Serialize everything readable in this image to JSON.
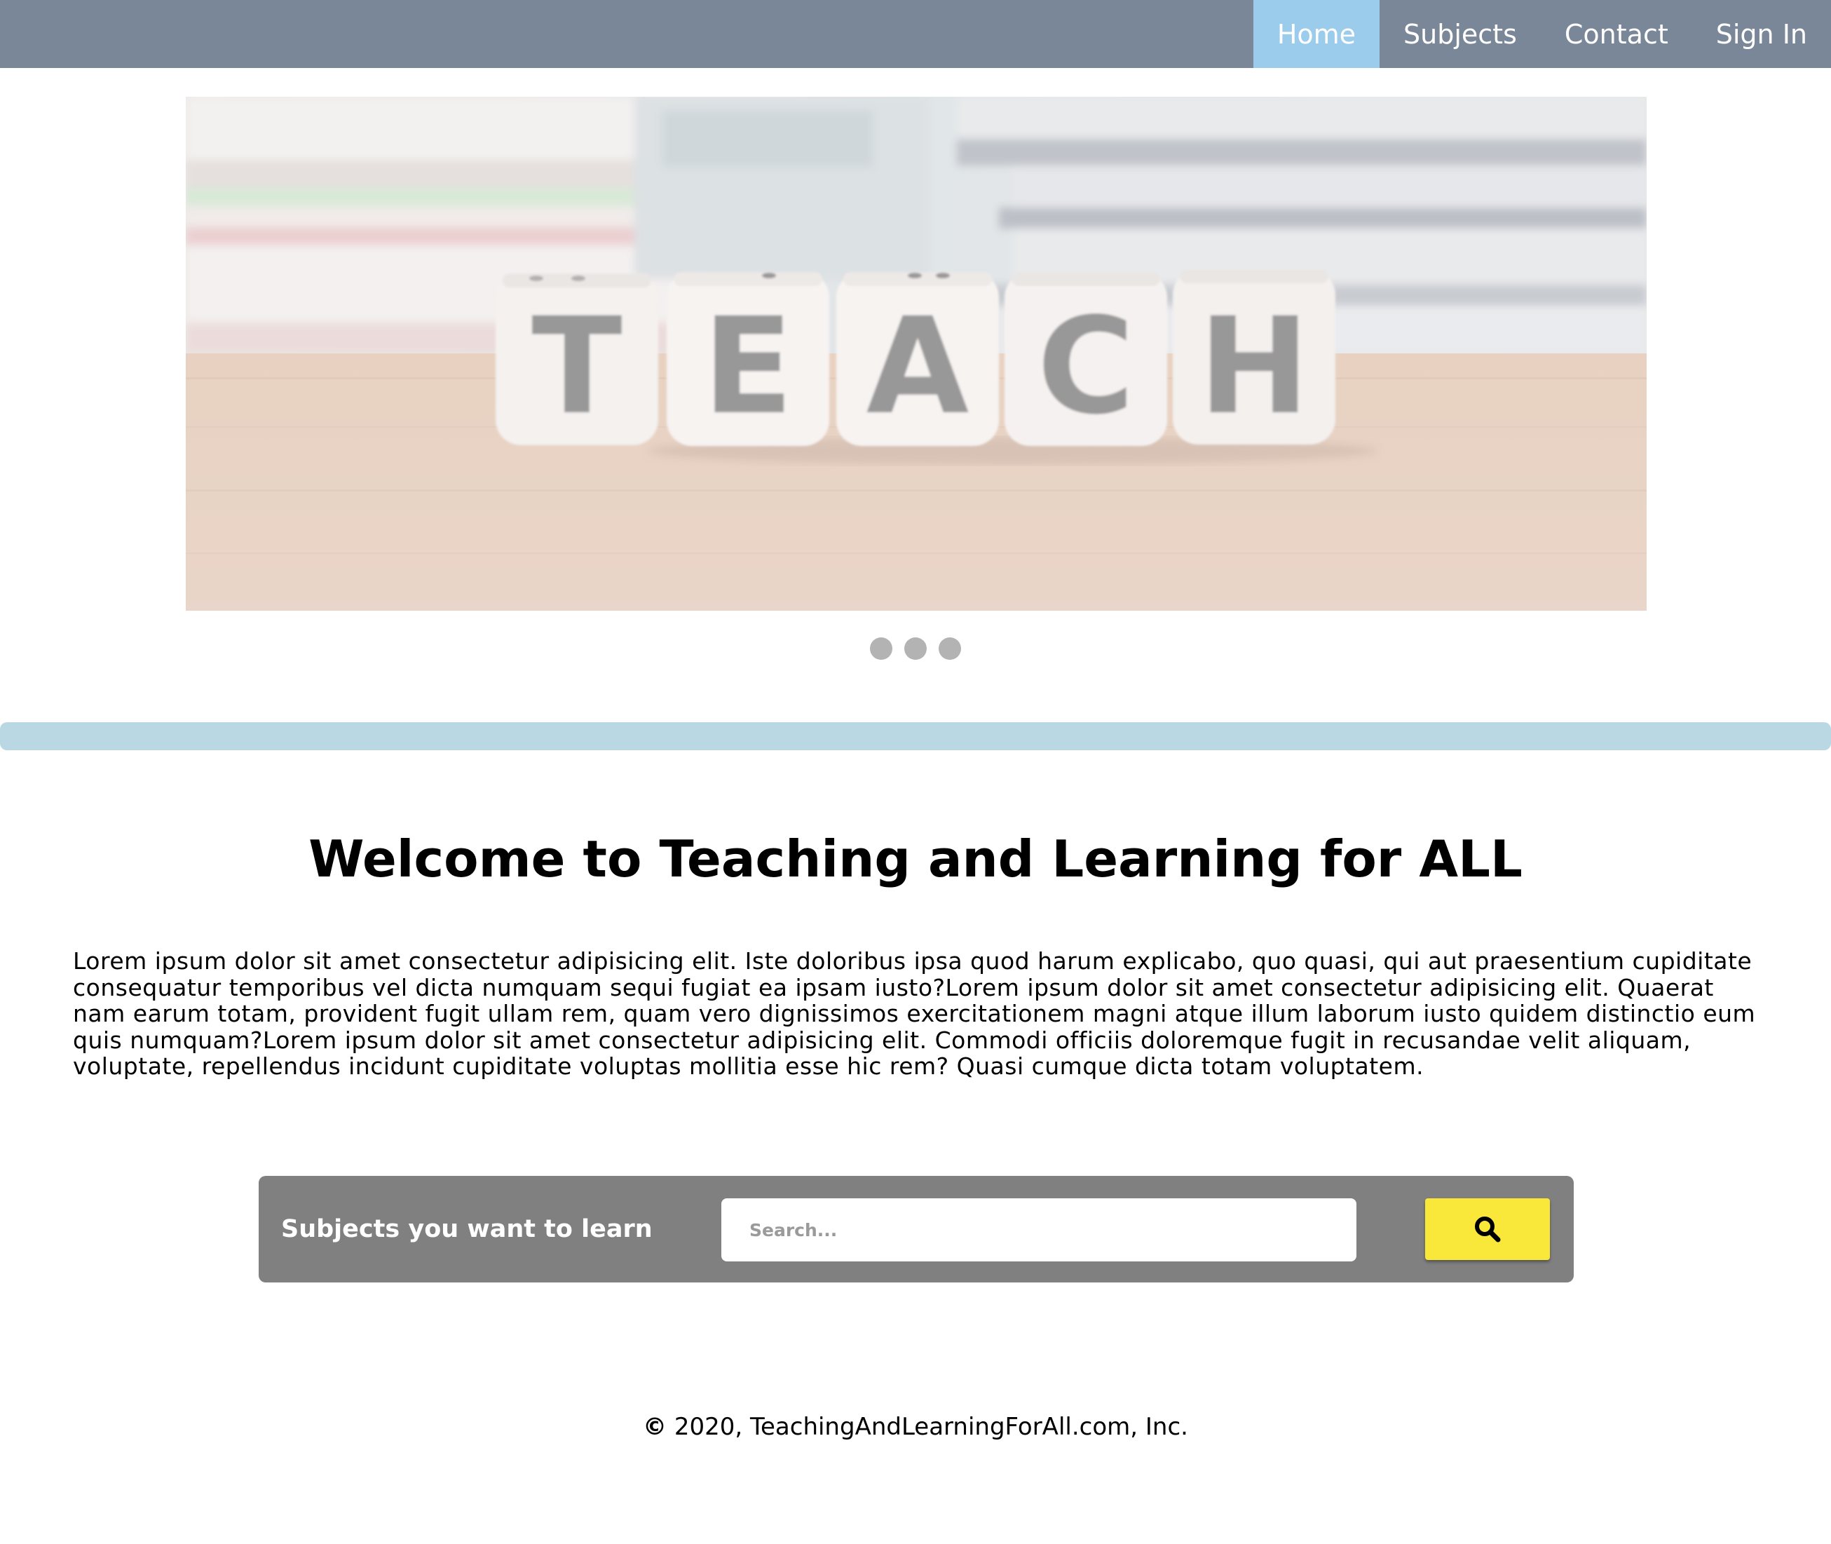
{
  "nav": {
    "items": [
      {
        "label": "Home",
        "active": true
      },
      {
        "label": "Subjects",
        "active": false
      },
      {
        "label": "Contact",
        "active": false
      },
      {
        "label": "Sign In",
        "active": false
      }
    ]
  },
  "hero": {
    "image_text": "TEACH",
    "slide_count": 3
  },
  "welcome": {
    "title": "Welcome to Teaching and Learning for ALL",
    "body": "Lorem ipsum dolor sit amet consectetur adipisicing elit. Iste doloribus ipsa quod harum explicabo, quo quasi, qui aut praesentium cupiditate consequatur temporibus vel dicta numquam sequi fugiat ea ipsam iusto?Lorem ipsum dolor sit amet consectetur adipisicing elit. Quaerat nam earum totam, provident fugit ullam rem, quam vero dignissimos exercitationem magni atque illum laborum iusto quidem distinctio eum quis numquam?Lorem ipsum dolor sit amet consectetur adipisicing elit. Commodi officiis doloremque fugit in recusandae velit aliquam, voluptate, repellendus incidunt cupiditate voluptas mollitia esse hic rem? Quasi cumque dicta totam voluptatem."
  },
  "search": {
    "label": "Subjects you want to learn",
    "placeholder": "Search...",
    "value": "",
    "button_icon": "search-icon"
  },
  "footer": {
    "copyright_symbol": "©",
    "text": "2020, TeachingAndLearningForAll.com, Inc."
  },
  "colors": {
    "nav_bg": "#7a8798",
    "nav_active": "#9cccec",
    "divider": "#bad8e4",
    "search_panel": "#808080",
    "search_button": "#f9e73a",
    "dot": "#b3b3b3"
  }
}
